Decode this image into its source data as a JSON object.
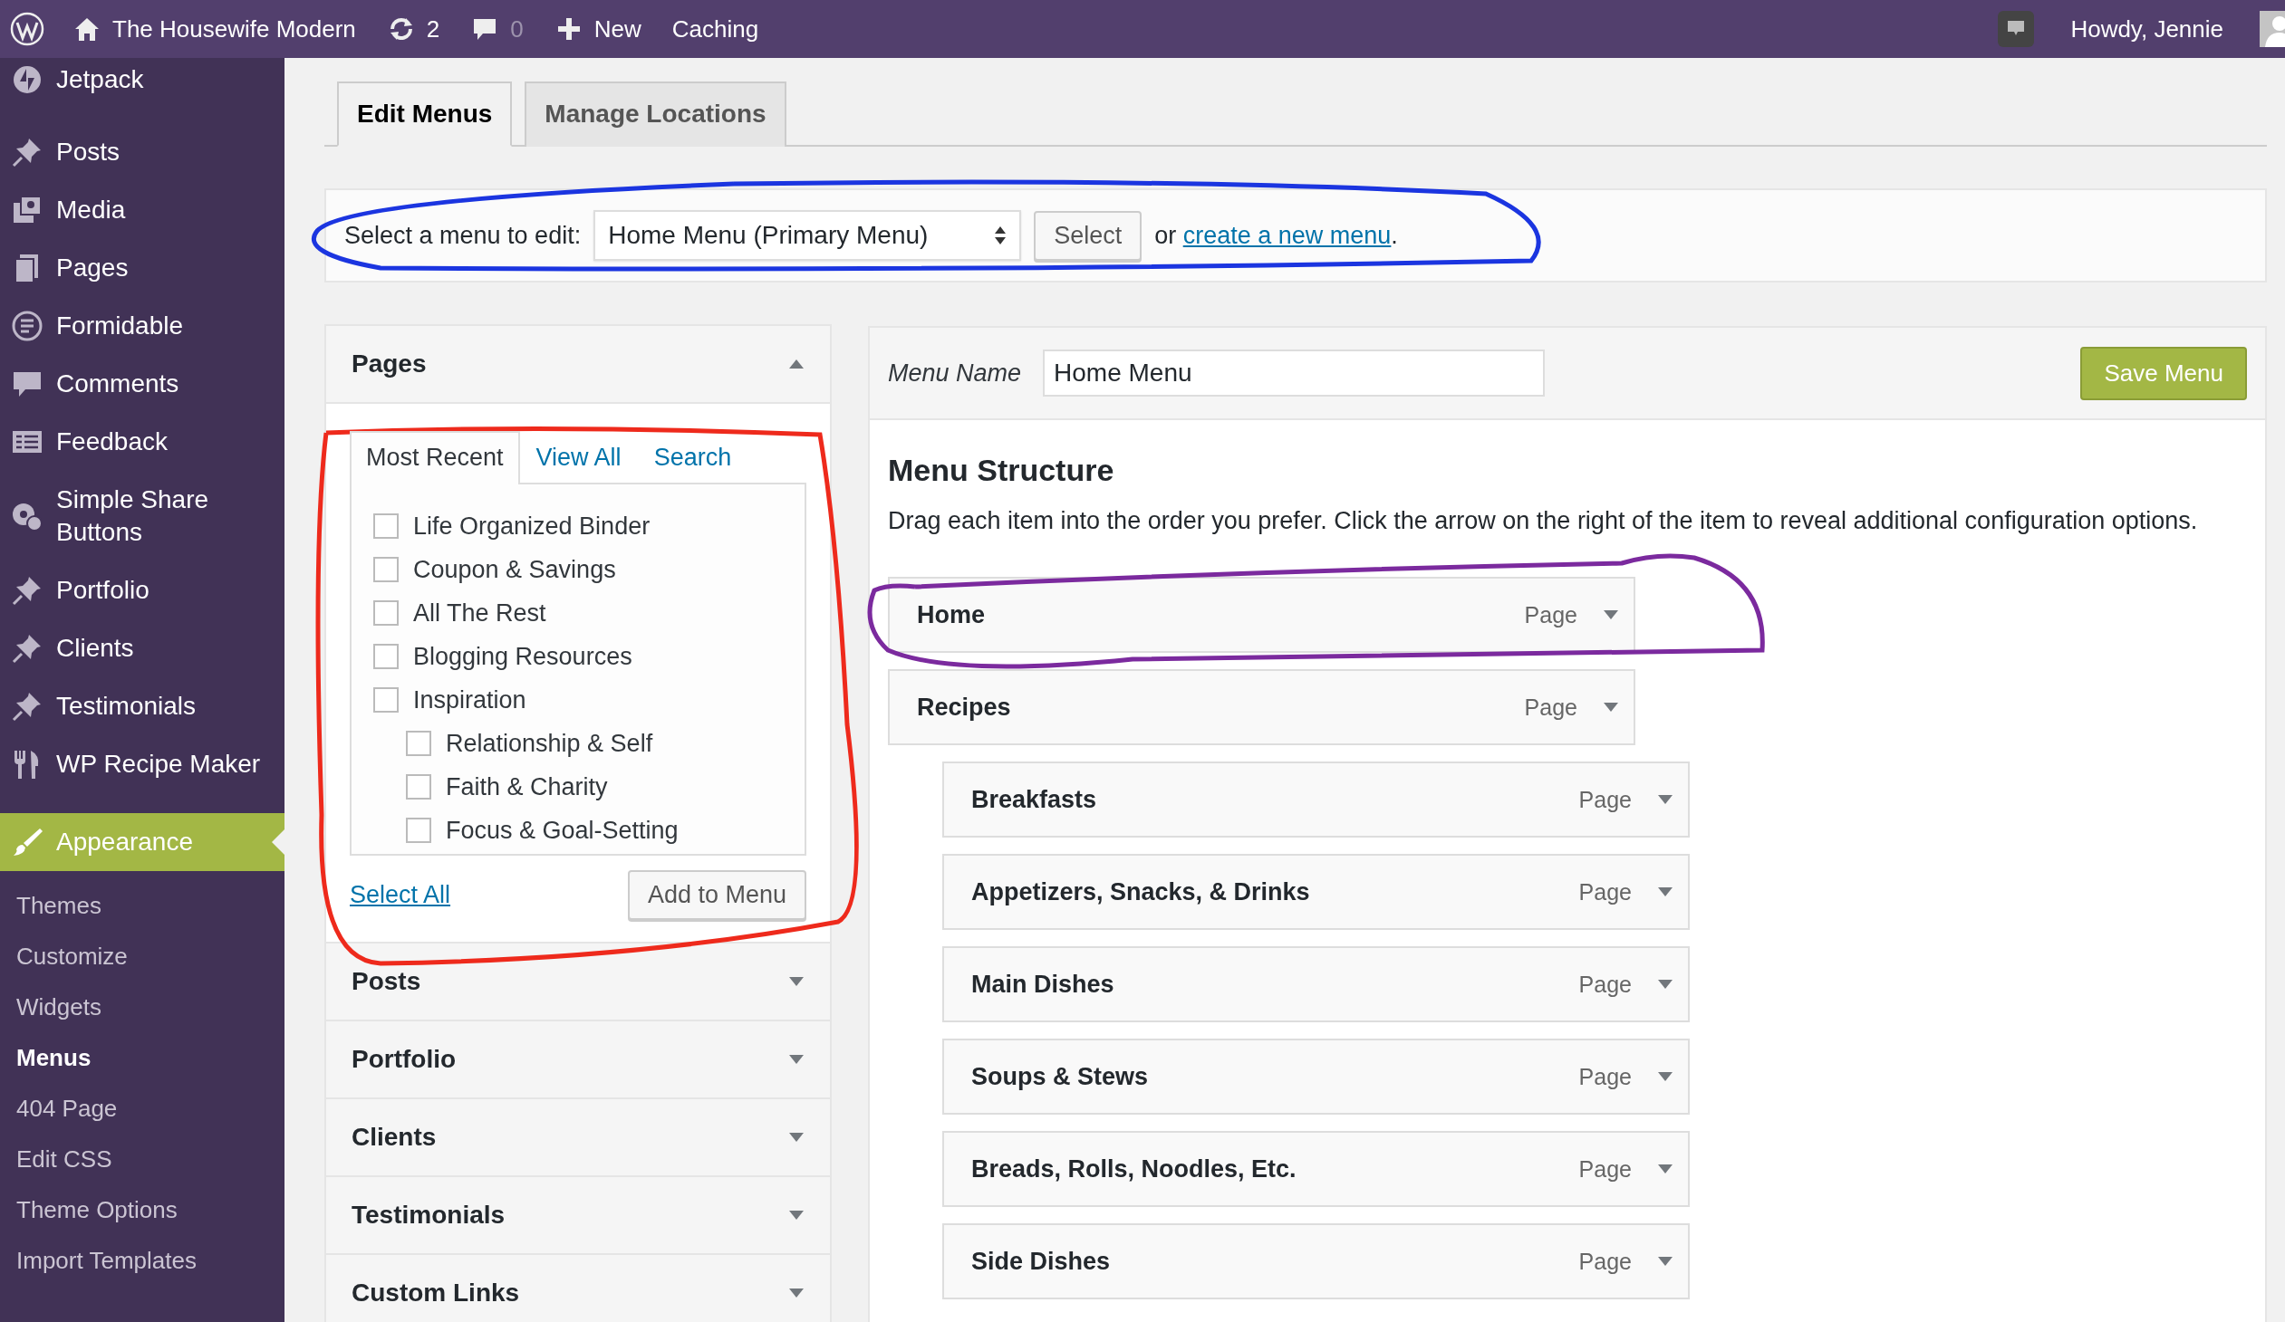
{
  "admin_bar": {
    "site_name": "The Housewife Modern",
    "updates": "2",
    "comments": "0",
    "new": "New",
    "caching": "Caching",
    "greeting": "Howdy, Jennie"
  },
  "sidebar": {
    "items": [
      {
        "label": "Jetpack",
        "kind": "jetpack",
        "selected": false
      },
      {
        "label": "Posts",
        "kind": "pin",
        "selected": false
      },
      {
        "label": "Media",
        "kind": "media",
        "selected": false
      },
      {
        "label": "Pages",
        "kind": "pages",
        "selected": false
      },
      {
        "label": "Formidable",
        "kind": "form",
        "selected": false
      },
      {
        "label": "Comments",
        "kind": "comment",
        "selected": false
      },
      {
        "label": "Feedback",
        "kind": "feedback",
        "selected": false
      },
      {
        "label": "Simple Share Buttons",
        "kind": "share",
        "selected": false
      },
      {
        "label": "Portfolio",
        "kind": "pin",
        "selected": false
      },
      {
        "label": "Clients",
        "kind": "pin",
        "selected": false
      },
      {
        "label": "Testimonials",
        "kind": "pin",
        "selected": false
      },
      {
        "label": "WP Recipe Maker",
        "kind": "utensils",
        "selected": false
      },
      {
        "label": "Appearance",
        "kind": "brush",
        "selected": true
      }
    ],
    "submenu": [
      {
        "label": "Themes",
        "selected": false
      },
      {
        "label": "Customize",
        "selected": false
      },
      {
        "label": "Widgets",
        "selected": false
      },
      {
        "label": "Menus",
        "selected": true
      },
      {
        "label": "404 Page",
        "selected": false
      },
      {
        "label": "Edit CSS",
        "selected": false
      },
      {
        "label": "Theme Options",
        "selected": false
      },
      {
        "label": "Import Templates",
        "selected": false
      }
    ]
  },
  "tabs": [
    {
      "label": "Edit Menus",
      "selected": true
    },
    {
      "label": "Manage Locations",
      "selected": false
    }
  ],
  "menu_select": {
    "label": "Select a menu to edit:",
    "value": "Home Menu (Primary Menu)",
    "button": "Select",
    "or": "or",
    "link": "create a new menu",
    "after": "."
  },
  "panels": [
    {
      "title": "Pages",
      "expanded": true
    },
    {
      "title": "Posts",
      "expanded": false
    },
    {
      "title": "Portfolio",
      "expanded": false
    },
    {
      "title": "Clients",
      "expanded": false
    },
    {
      "title": "Testimonials",
      "expanded": false
    },
    {
      "title": "Custom Links",
      "expanded": false
    }
  ],
  "pages_box": {
    "tabs": [
      {
        "label": "Most Recent",
        "selected": true
      },
      {
        "label": "View All",
        "selected": false
      },
      {
        "label": "Search",
        "selected": false
      }
    ],
    "items": [
      {
        "label": "Life Organized Binder",
        "checked": false
      },
      {
        "label": "Coupon & Savings",
        "checked": false
      },
      {
        "label": "All The Rest",
        "checked": false
      },
      {
        "label": "Blogging Resources",
        "checked": false
      },
      {
        "label": "Inspiration",
        "checked": false,
        "children": [
          {
            "label": "Relationship & Self",
            "checked": false
          },
          {
            "label": "Faith & Charity",
            "checked": false
          },
          {
            "label": "Focus & Goal-Setting",
            "checked": false
          }
        ]
      }
    ],
    "select_all": "Select All",
    "add_button": "Add to Menu"
  },
  "menu_name": {
    "label": "Menu Name",
    "value": "Home Menu"
  },
  "save_button": "Save Menu",
  "structure": {
    "title": "Menu Structure",
    "description": "Drag each item into the order you prefer. Click the arrow on the right of the item to reveal additional configuration options.",
    "items": [
      {
        "title": "Home",
        "type": "Page"
      },
      {
        "title": "Recipes",
        "type": "Page",
        "children": [
          {
            "title": "Breakfasts",
            "type": "Page"
          },
          {
            "title": "Appetizers, Snacks, & Drinks",
            "type": "Page"
          },
          {
            "title": "Main Dishes",
            "type": "Page"
          },
          {
            "title": "Soups & Stews",
            "type": "Page"
          },
          {
            "title": "Breads, Rolls, Noodles, Etc.",
            "type": "Page"
          },
          {
            "title": "Side Dishes",
            "type": "Page"
          }
        ]
      }
    ]
  },
  "annotations": [
    {
      "color": "#1b35e0"
    },
    {
      "color": "#ee2a1c"
    },
    {
      "color": "#7b2a9e"
    }
  ]
}
